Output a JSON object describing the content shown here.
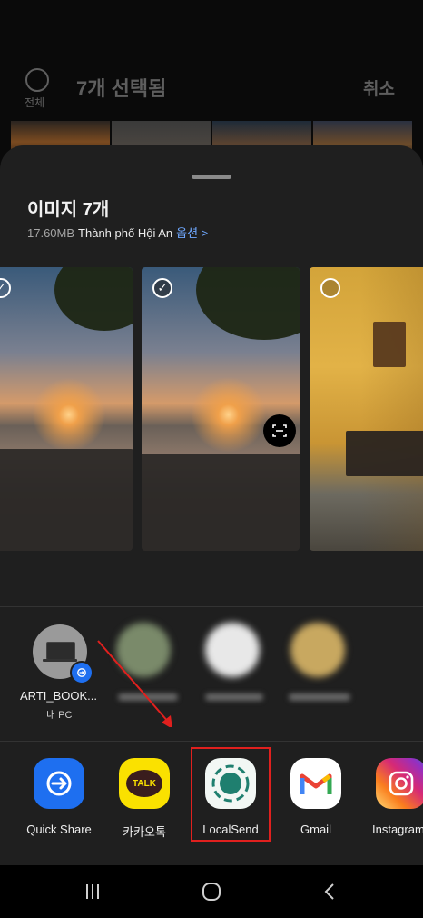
{
  "gallery": {
    "select_all_label": "전체",
    "selected_count_label": "7개 선택됨",
    "cancel_label": "취소"
  },
  "share": {
    "title": "이미지 7개",
    "size": "17.60MB",
    "location": "Thành phố Hội An",
    "options_label": "옵션 >"
  },
  "nearby": {
    "device_name": "ARTI_BOOK...",
    "device_subtitle": "내 PC"
  },
  "apps": [
    {
      "label": "Quick Share",
      "icon": "quick-share-icon",
      "color": "#1e6ff0"
    },
    {
      "label": "카카오톡",
      "icon": "kakaotalk-icon",
      "color": "#fae100"
    },
    {
      "label": "LocalSend",
      "icon": "localsend-icon",
      "color": "#1f7f6f"
    },
    {
      "label": "Gmail",
      "icon": "gmail-icon",
      "color": "#ffffff"
    },
    {
      "label": "Instagram",
      "icon": "instagram-icon",
      "color": "#d62976"
    }
  ],
  "colors": {
    "sheet_background": "#1f1f1f",
    "annotation_red": "#e0201e",
    "link_blue": "#6fa8ff"
  }
}
